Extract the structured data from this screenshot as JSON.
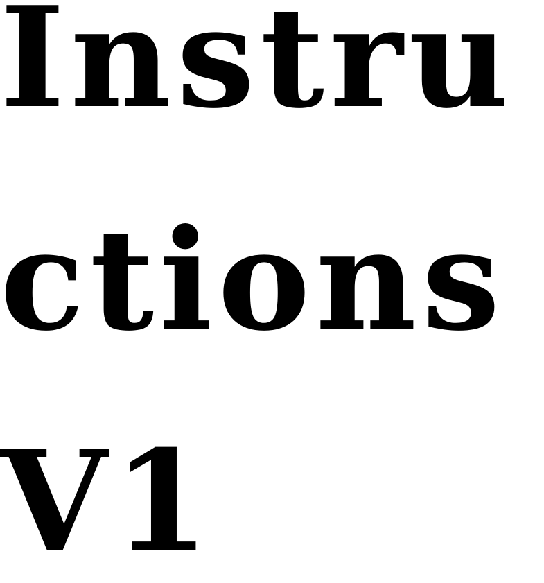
{
  "title": {
    "lines": [
      "Instru",
      "ctions",
      "V1"
    ]
  },
  "colors": {
    "background": "#ffffff",
    "text": "#000000"
  }
}
